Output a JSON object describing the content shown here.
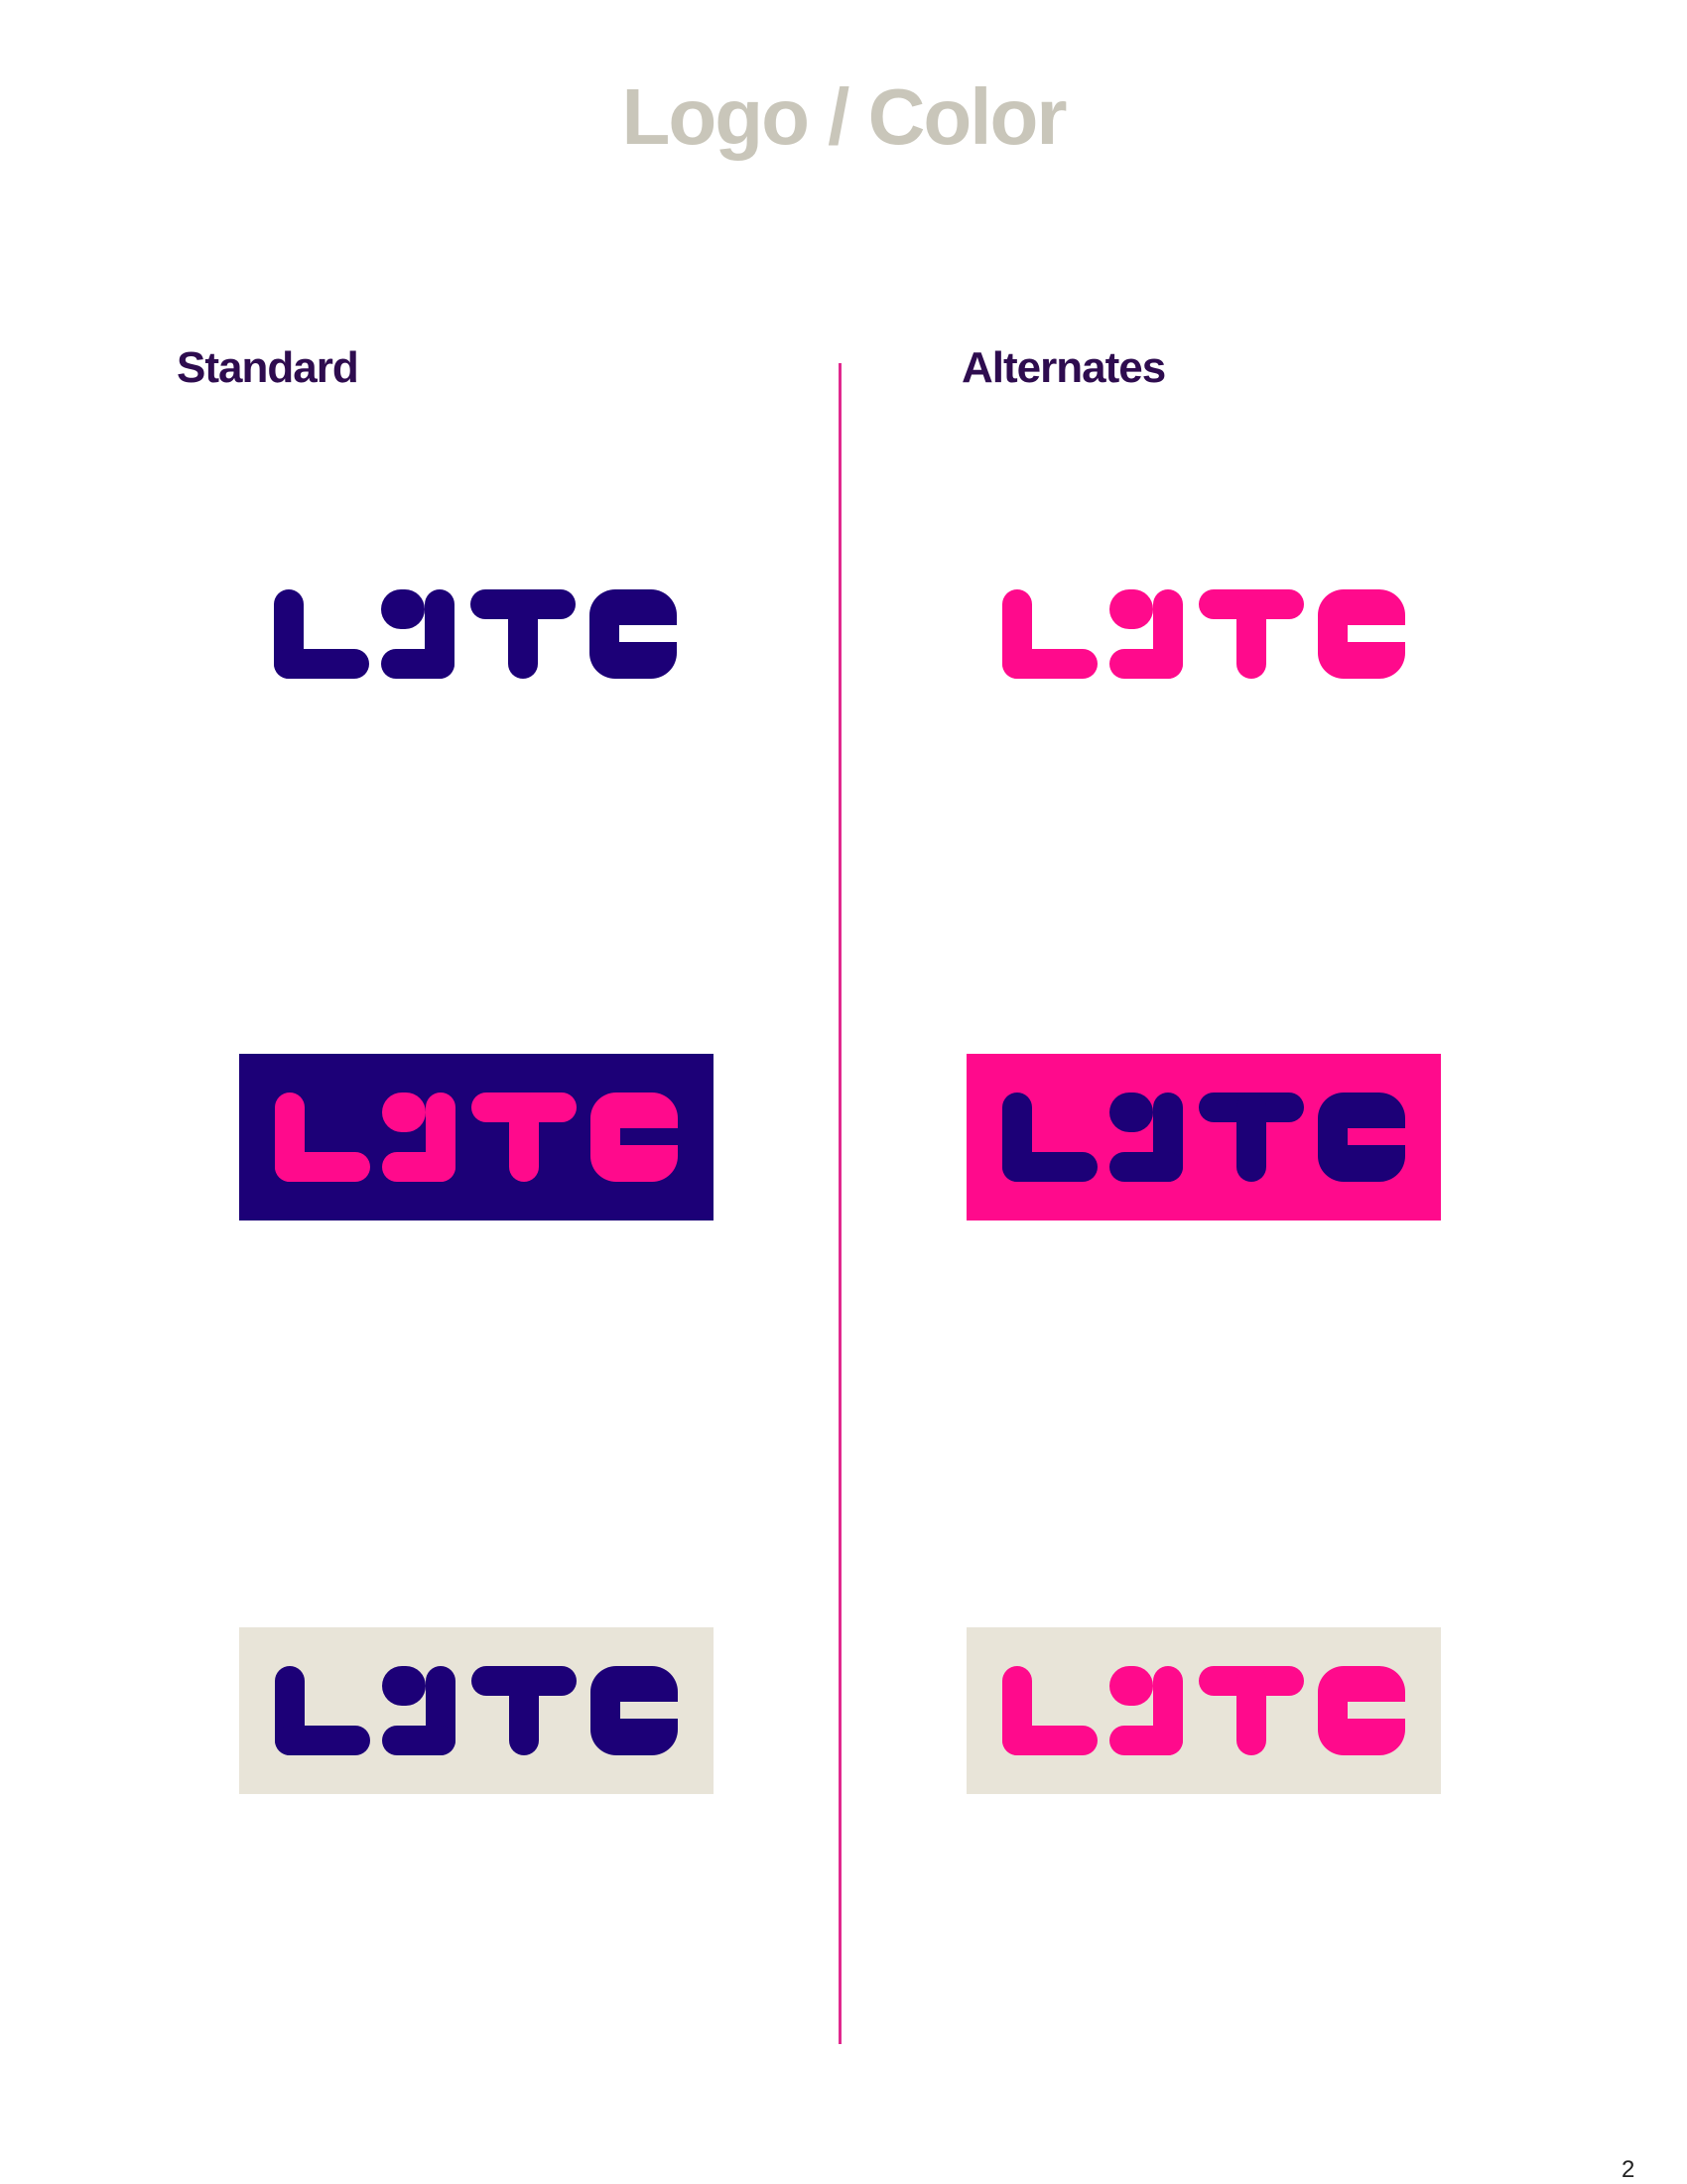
{
  "page": {
    "title": "Logo / Color",
    "page_number": "2"
  },
  "columns": {
    "standard": {
      "heading": "Standard"
    },
    "alternates": {
      "heading": "Alternates"
    }
  },
  "colors": {
    "navy": "#1c0077",
    "pink": "#ff0a8c",
    "beige": "#e8e4d8",
    "title_gray": "#c9c6ba",
    "heading_purple": "#2e0c4f",
    "divider_pink": "#e0288e"
  },
  "logo": {
    "wordmark": "LYTE",
    "variants": [
      {
        "id": "standard-plain",
        "logo_color": "navy",
        "background": "none"
      },
      {
        "id": "standard-on-navy",
        "logo_color": "pink",
        "background": "navy"
      },
      {
        "id": "standard-on-beige",
        "logo_color": "navy",
        "background": "beige"
      },
      {
        "id": "alternate-plain",
        "logo_color": "pink",
        "background": "none"
      },
      {
        "id": "alternate-on-pink",
        "logo_color": "navy",
        "background": "pink"
      },
      {
        "id": "alternate-on-beige",
        "logo_color": "pink",
        "background": "beige"
      }
    ]
  }
}
